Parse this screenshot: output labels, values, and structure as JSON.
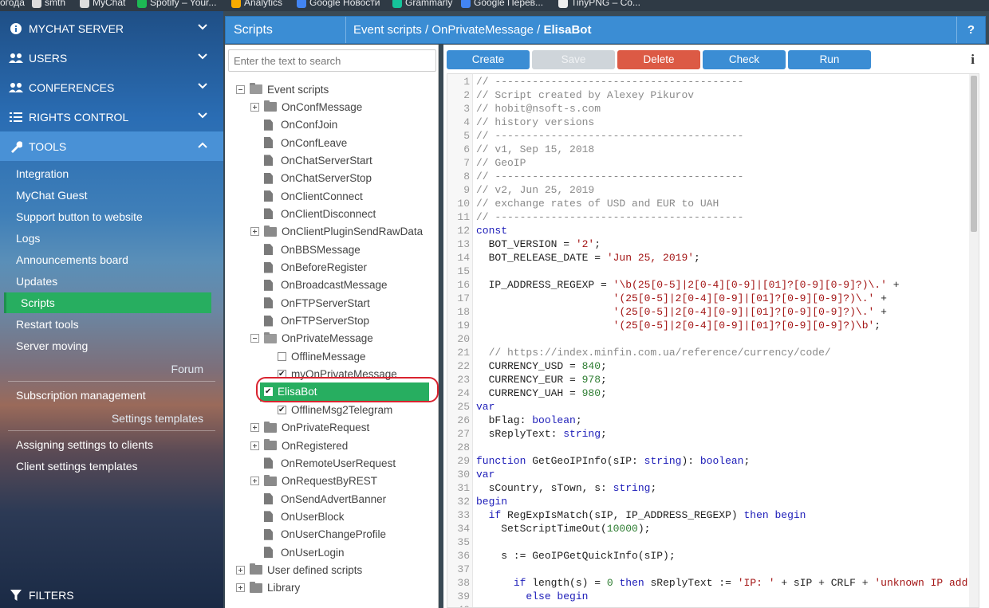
{
  "bookmarks": [
    "огода",
    "smth",
    "MyChat",
    "Spotify – Your...",
    "Analytics",
    "Google Новости",
    "Grammarly",
    "Google Перев...",
    "TinyPNG – Co..."
  ],
  "sidebar": {
    "sections": [
      {
        "label": "MYCHAT SERVER",
        "icon": "info-circle-icon"
      },
      {
        "label": "USERS",
        "icon": "users-icon"
      },
      {
        "label": "CONFERENCES",
        "icon": "conferences-icon"
      },
      {
        "label": "RIGHTS CONTROL",
        "icon": "list-icon"
      },
      {
        "label": "TOOLS",
        "icon": "wrench-icon"
      }
    ],
    "tools_items": [
      "Integration",
      "MyChat Guest",
      "Support button to website",
      "Logs",
      "Announcements board",
      "Updates",
      "Scripts",
      "Restart tools",
      "Server moving"
    ],
    "forum_header": "Forum",
    "forum_items": [
      "Subscription management"
    ],
    "settings_header": "Settings templates",
    "settings_items": [
      "Assigning settings to clients",
      "Client settings templates"
    ],
    "filters_label": "FILTERS"
  },
  "topbar": {
    "title": "Scripts",
    "path_prefix": "Event scripts / OnPrivateMessage / ",
    "path_current": "ElisaBot",
    "help": "?"
  },
  "search": {
    "placeholder": "Enter the text to search"
  },
  "tree": [
    {
      "label": "Event scripts",
      "type": "folder-open",
      "expander": "minus",
      "indent": 0
    },
    {
      "label": "OnConfMessage",
      "type": "folder",
      "expander": "plus",
      "indent": 1
    },
    {
      "label": "OnConfJoin",
      "type": "doc",
      "expander": "none",
      "indent": 1
    },
    {
      "label": "OnConfLeave",
      "type": "doc",
      "expander": "none",
      "indent": 1
    },
    {
      "label": "OnChatServerStart",
      "type": "doc",
      "expander": "none",
      "indent": 1
    },
    {
      "label": "OnChatServerStop",
      "type": "doc",
      "expander": "none",
      "indent": 1
    },
    {
      "label": "OnClientConnect",
      "type": "doc",
      "expander": "none",
      "indent": 1
    },
    {
      "label": "OnClientDisconnect",
      "type": "doc",
      "expander": "none",
      "indent": 1
    },
    {
      "label": "OnClientPluginSendRawData",
      "type": "folder",
      "expander": "plus",
      "indent": 1
    },
    {
      "label": "OnBBSMessage",
      "type": "doc",
      "expander": "none",
      "indent": 1
    },
    {
      "label": "OnBeforeRegister",
      "type": "doc",
      "expander": "none",
      "indent": 1
    },
    {
      "label": "OnBroadcastMessage",
      "type": "doc",
      "expander": "none",
      "indent": 1
    },
    {
      "label": "OnFTPServerStart",
      "type": "doc",
      "expander": "none",
      "indent": 1
    },
    {
      "label": "OnFTPServerStop",
      "type": "doc",
      "expander": "none",
      "indent": 1
    },
    {
      "label": "OnPrivateMessage",
      "type": "folder-open",
      "expander": "minus",
      "indent": 1
    },
    {
      "label": "OfflineMessage",
      "type": "check",
      "checked": false,
      "indent": 2
    },
    {
      "label": "myOnPrivateMessage",
      "type": "check",
      "checked": true,
      "indent": 2
    },
    {
      "label": "ElisaBot",
      "type": "check",
      "checked": true,
      "indent": 2,
      "selected": true
    },
    {
      "label": "OfflineMsg2Telegram",
      "type": "check",
      "checked": true,
      "indent": 2
    },
    {
      "label": "OnPrivateRequest",
      "type": "folder",
      "expander": "plus",
      "indent": 1
    },
    {
      "label": "OnRegistered",
      "type": "folder",
      "expander": "plus",
      "indent": 1
    },
    {
      "label": "OnRemoteUserRequest",
      "type": "doc",
      "expander": "none",
      "indent": 1
    },
    {
      "label": "OnRequestByREST",
      "type": "folder",
      "expander": "plus",
      "indent": 1
    },
    {
      "label": "OnSendAdvertBanner",
      "type": "doc",
      "expander": "none",
      "indent": 1
    },
    {
      "label": "OnUserBlock",
      "type": "doc",
      "expander": "none",
      "indent": 1
    },
    {
      "label": "OnUserChangeProfile",
      "type": "doc",
      "expander": "none",
      "indent": 1
    },
    {
      "label": "OnUserLogin",
      "type": "doc",
      "expander": "none",
      "indent": 1
    },
    {
      "label": "User defined scripts",
      "type": "folder",
      "expander": "plus",
      "indent": 0
    },
    {
      "label": "Library",
      "type": "folder",
      "expander": "plus",
      "indent": 0
    }
  ],
  "toolbar": {
    "create": "Create",
    "save": "Save",
    "delete": "Delete",
    "check": "Check",
    "run": "Run",
    "info": "i"
  },
  "colors": {
    "accent_blue": "#3b8dd4",
    "selected_green": "#27ae60",
    "delete_red": "#dc5a45",
    "highlight_oval": "#d9232f"
  },
  "code_lines": [
    [
      [
        "c",
        "// ----------------------------------------"
      ]
    ],
    [
      [
        "c",
        "// Script created by Alexey Pikurov"
      ]
    ],
    [
      [
        "c",
        "// hobit@nsoft-s.com"
      ]
    ],
    [
      [
        "c",
        "// history versions"
      ]
    ],
    [
      [
        "c",
        "// ----------------------------------------"
      ]
    ],
    [
      [
        "c",
        "// v1, Sep 15, 2018"
      ]
    ],
    [
      [
        "c",
        "// GeoIP"
      ]
    ],
    [
      [
        "c",
        "// ----------------------------------------"
      ]
    ],
    [
      [
        "c",
        "// v2, Jun 25, 2019"
      ]
    ],
    [
      [
        "c",
        "// exchange rates of USD and EUR to UAH"
      ]
    ],
    [
      [
        "c",
        "// ----------------------------------------"
      ]
    ],
    [
      [
        "k",
        "const"
      ]
    ],
    [
      [
        "p",
        "  BOT_VERSION = "
      ],
      [
        "s",
        "'2'"
      ],
      [
        "p",
        ";"
      ]
    ],
    [
      [
        "p",
        "  BOT_RELEASE_DATE = "
      ],
      [
        "s",
        "'Jun 25, 2019'"
      ],
      [
        "p",
        ";"
      ]
    ],
    [],
    [
      [
        "p",
        "  IP_ADDRESS_REGEXP = "
      ],
      [
        "s",
        "'\\b(25[0-5]|2[0-4][0-9]|[01]?[0-9][0-9]?)\\.'"
      ],
      [
        "p",
        " +"
      ]
    ],
    [
      [
        "p",
        "                      "
      ],
      [
        "s",
        "'(25[0-5]|2[0-4][0-9]|[01]?[0-9][0-9]?)\\.'"
      ],
      [
        "p",
        " +"
      ]
    ],
    [
      [
        "p",
        "                      "
      ],
      [
        "s",
        "'(25[0-5]|2[0-4][0-9]|[01]?[0-9][0-9]?)\\.'"
      ],
      [
        "p",
        " +"
      ]
    ],
    [
      [
        "p",
        "                      "
      ],
      [
        "s",
        "'(25[0-5]|2[0-4][0-9]|[01]?[0-9][0-9]?)\\b'"
      ],
      [
        "p",
        ";"
      ]
    ],
    [],
    [
      [
        "c",
        "  // https://index.minfin.com.ua/reference/currency/code/"
      ]
    ],
    [
      [
        "p",
        "  CURRENCY_USD = "
      ],
      [
        "n",
        "840"
      ],
      [
        "p",
        ";"
      ]
    ],
    [
      [
        "p",
        "  CURRENCY_EUR = "
      ],
      [
        "n",
        "978"
      ],
      [
        "p",
        ";"
      ]
    ],
    [
      [
        "p",
        "  CURRENCY_UAH = "
      ],
      [
        "n",
        "980"
      ],
      [
        "p",
        ";"
      ]
    ],
    [
      [
        "k",
        "var"
      ]
    ],
    [
      [
        "p",
        "  bFlag: "
      ],
      [
        "k",
        "boolean"
      ],
      [
        "p",
        ";"
      ]
    ],
    [
      [
        "p",
        "  sReplyText: "
      ],
      [
        "k",
        "string"
      ],
      [
        "p",
        ";"
      ]
    ],
    [],
    [
      [
        "k",
        "function"
      ],
      [
        "p",
        " GetGeoIPInfo(sIP: "
      ],
      [
        "k",
        "string"
      ],
      [
        "p",
        "): "
      ],
      [
        "k",
        "boolean"
      ],
      [
        "p",
        ";"
      ]
    ],
    [
      [
        "k",
        "var"
      ]
    ],
    [
      [
        "p",
        "  sCountry, sTown, s: "
      ],
      [
        "k",
        "string"
      ],
      [
        "p",
        ";"
      ]
    ],
    [
      [
        "k",
        "begin"
      ]
    ],
    [
      [
        "p",
        "  "
      ],
      [
        "k",
        "if"
      ],
      [
        "p",
        " RegExpIsMatch(sIP, IP_ADDRESS_REGEXP) "
      ],
      [
        "k",
        "then begin"
      ]
    ],
    [
      [
        "p",
        "    SetScriptTimeOut("
      ],
      [
        "n",
        "10000"
      ],
      [
        "p",
        ");"
      ]
    ],
    [],
    [
      [
        "p",
        "    s := GeoIPGetQuickInfo(sIP);"
      ]
    ],
    [],
    [
      [
        "p",
        "      "
      ],
      [
        "k",
        "if"
      ],
      [
        "p",
        " length(s) = "
      ],
      [
        "n",
        "0"
      ],
      [
        "p",
        " "
      ],
      [
        "k",
        "then"
      ],
      [
        "p",
        " sReplyText := "
      ],
      [
        "s",
        "'IP: '"
      ],
      [
        "p",
        " + sIP + CRLF + "
      ],
      [
        "s",
        "'unknown IP address'"
      ]
    ],
    [
      [
        "p",
        "        "
      ],
      [
        "k",
        "else begin"
      ]
    ],
    [
      [
        "p",
        "                                    "
      ]
    ]
  ]
}
